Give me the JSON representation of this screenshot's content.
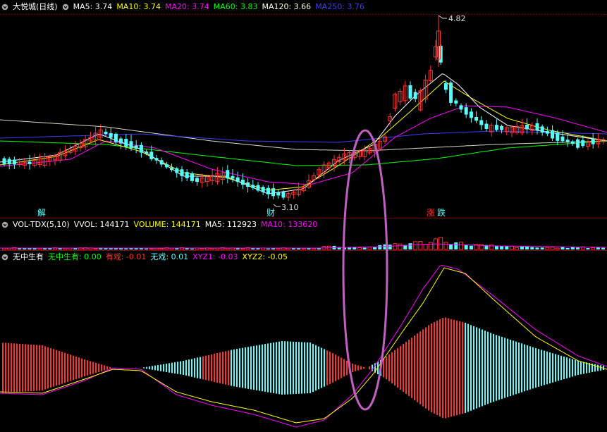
{
  "colors": {
    "bg": "#000000",
    "up": "#ff3232",
    "down": "#54ffff",
    "grid": "#800000",
    "ma5": "#ffffff",
    "ma10": "#ffff00",
    "ma20": "#ff00ff",
    "ma60": "#00ff00",
    "ma120": "#ffffe0",
    "ma250": "#3c3cff",
    "ellipse": "#c060c0"
  },
  "main_legend": {
    "title": "大悦城(日线)",
    "ma5": "MA5: 3.74",
    "ma10": "MA10: 3.74",
    "ma20": "MA20: 3.74",
    "ma60": "MA60: 3.83",
    "ma120": "MA120: 3.66",
    "ma250": "MA250: 3.76"
  },
  "vol_legend": {
    "title": "VOL-TDX(5,10)",
    "vvol": "VVOL: 144171",
    "volume": "VOLUME: 144171",
    "ma5": "MA5: 112923",
    "ma10": "MA10: 133620"
  },
  "ind_legend": {
    "title": "无中生有",
    "v1": "无中生有: 0.00",
    "v2": "有戏: -0.01",
    "v3": "无戏: 0.01",
    "v4": "XYZ1: -0.03",
    "v5": "XYZ2: -0.05"
  },
  "annotations": {
    "high_label": "4.82",
    "low_label": "3.10",
    "marker_jie": "解",
    "marker_cai": "财",
    "marker_zhang": "涨",
    "marker_die": "跌"
  }
}
